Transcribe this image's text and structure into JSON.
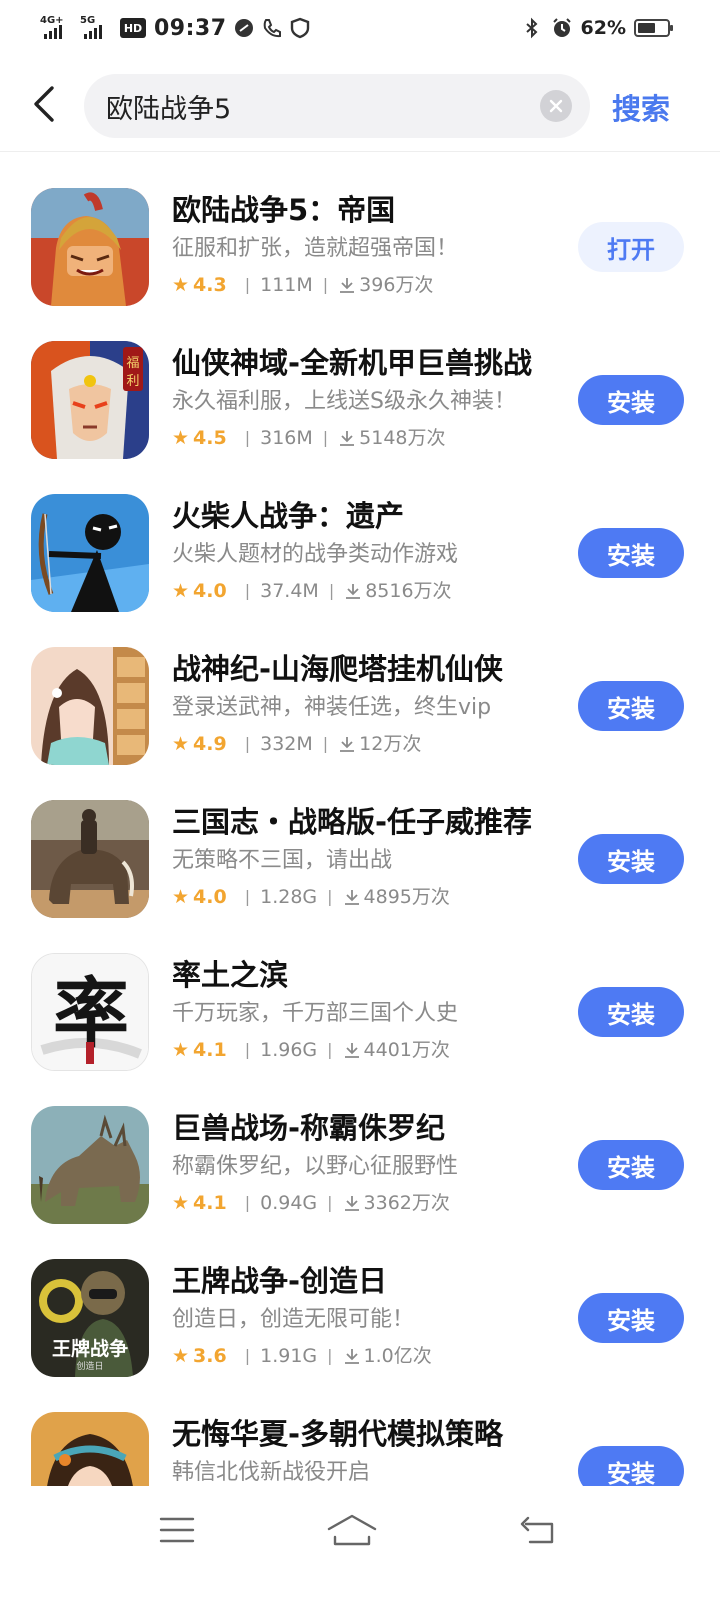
{
  "status_bar": {
    "network1": "4G+",
    "network2": "5G",
    "hd_label": "HD",
    "time": "09:37",
    "battery_pct": "62%",
    "battery_level": 0.62
  },
  "search": {
    "query": "欧陆战争5",
    "button_label": "搜索"
  },
  "apps": [
    {
      "name": "欧陆战争5：帝国",
      "desc": "征服和扩张，造就超强帝国！",
      "rating": "4.3",
      "size": "111M",
      "downloads": "396万次",
      "action": "打开"
    },
    {
      "name": "仙侠神域-全新机甲巨兽挑战",
      "desc": "永久福利服，上线送S级永久神装！",
      "rating": "4.5",
      "size": "316M",
      "downloads": "5148万次",
      "action": "安装"
    },
    {
      "name": "火柴人战争：遗产",
      "desc": "火柴人题材的战争类动作游戏",
      "rating": "4.0",
      "size": "37.4M",
      "downloads": "8516万次",
      "action": "安装"
    },
    {
      "name": "战神纪-山海爬塔挂机仙侠",
      "desc": "登录送武神，神装任选，终生vip",
      "rating": "4.9",
      "size": "332M",
      "downloads": "12万次",
      "action": "安装"
    },
    {
      "name": "三国志・战略版-任子威推荐",
      "desc": "无策略不三国，请出战",
      "rating": "4.0",
      "size": "1.28G",
      "downloads": "4895万次",
      "action": "安装"
    },
    {
      "name": "率土之滨",
      "desc": "千万玩家，千万部三国个人史",
      "rating": "4.1",
      "size": "1.96G",
      "downloads": "4401万次",
      "action": "安装",
      "icon_text": "率"
    },
    {
      "name": "巨兽战场-称霸侏罗纪",
      "desc": "称霸侏罗纪，以野心征服野性",
      "rating": "4.1",
      "size": "0.94G",
      "downloads": "3362万次",
      "action": "安装"
    },
    {
      "name": "王牌战争-创造日",
      "desc": "创造日，创造无限可能！",
      "rating": "3.6",
      "size": "1.91G",
      "downloads": "1.0亿次",
      "action": "安装",
      "icon_text": "王牌战争",
      "icon_subtext": "创造日"
    },
    {
      "name": "无悔华夏-多朝代模拟策略",
      "desc": "韩信北伐新战役开启",
      "rating": "",
      "size": "",
      "downloads": "",
      "action": "安装"
    }
  ],
  "icons": {
    "back": "chevron-left-icon",
    "clear": "close-icon",
    "rating": "star-icon",
    "download": "download-icon",
    "nav_menu": "menu-icon",
    "nav_home": "home-icon",
    "nav_back": "back-icon"
  },
  "colors": {
    "accent": "#4e7af3",
    "rating": "#f2a530",
    "open_bg": "#edf2fe"
  }
}
